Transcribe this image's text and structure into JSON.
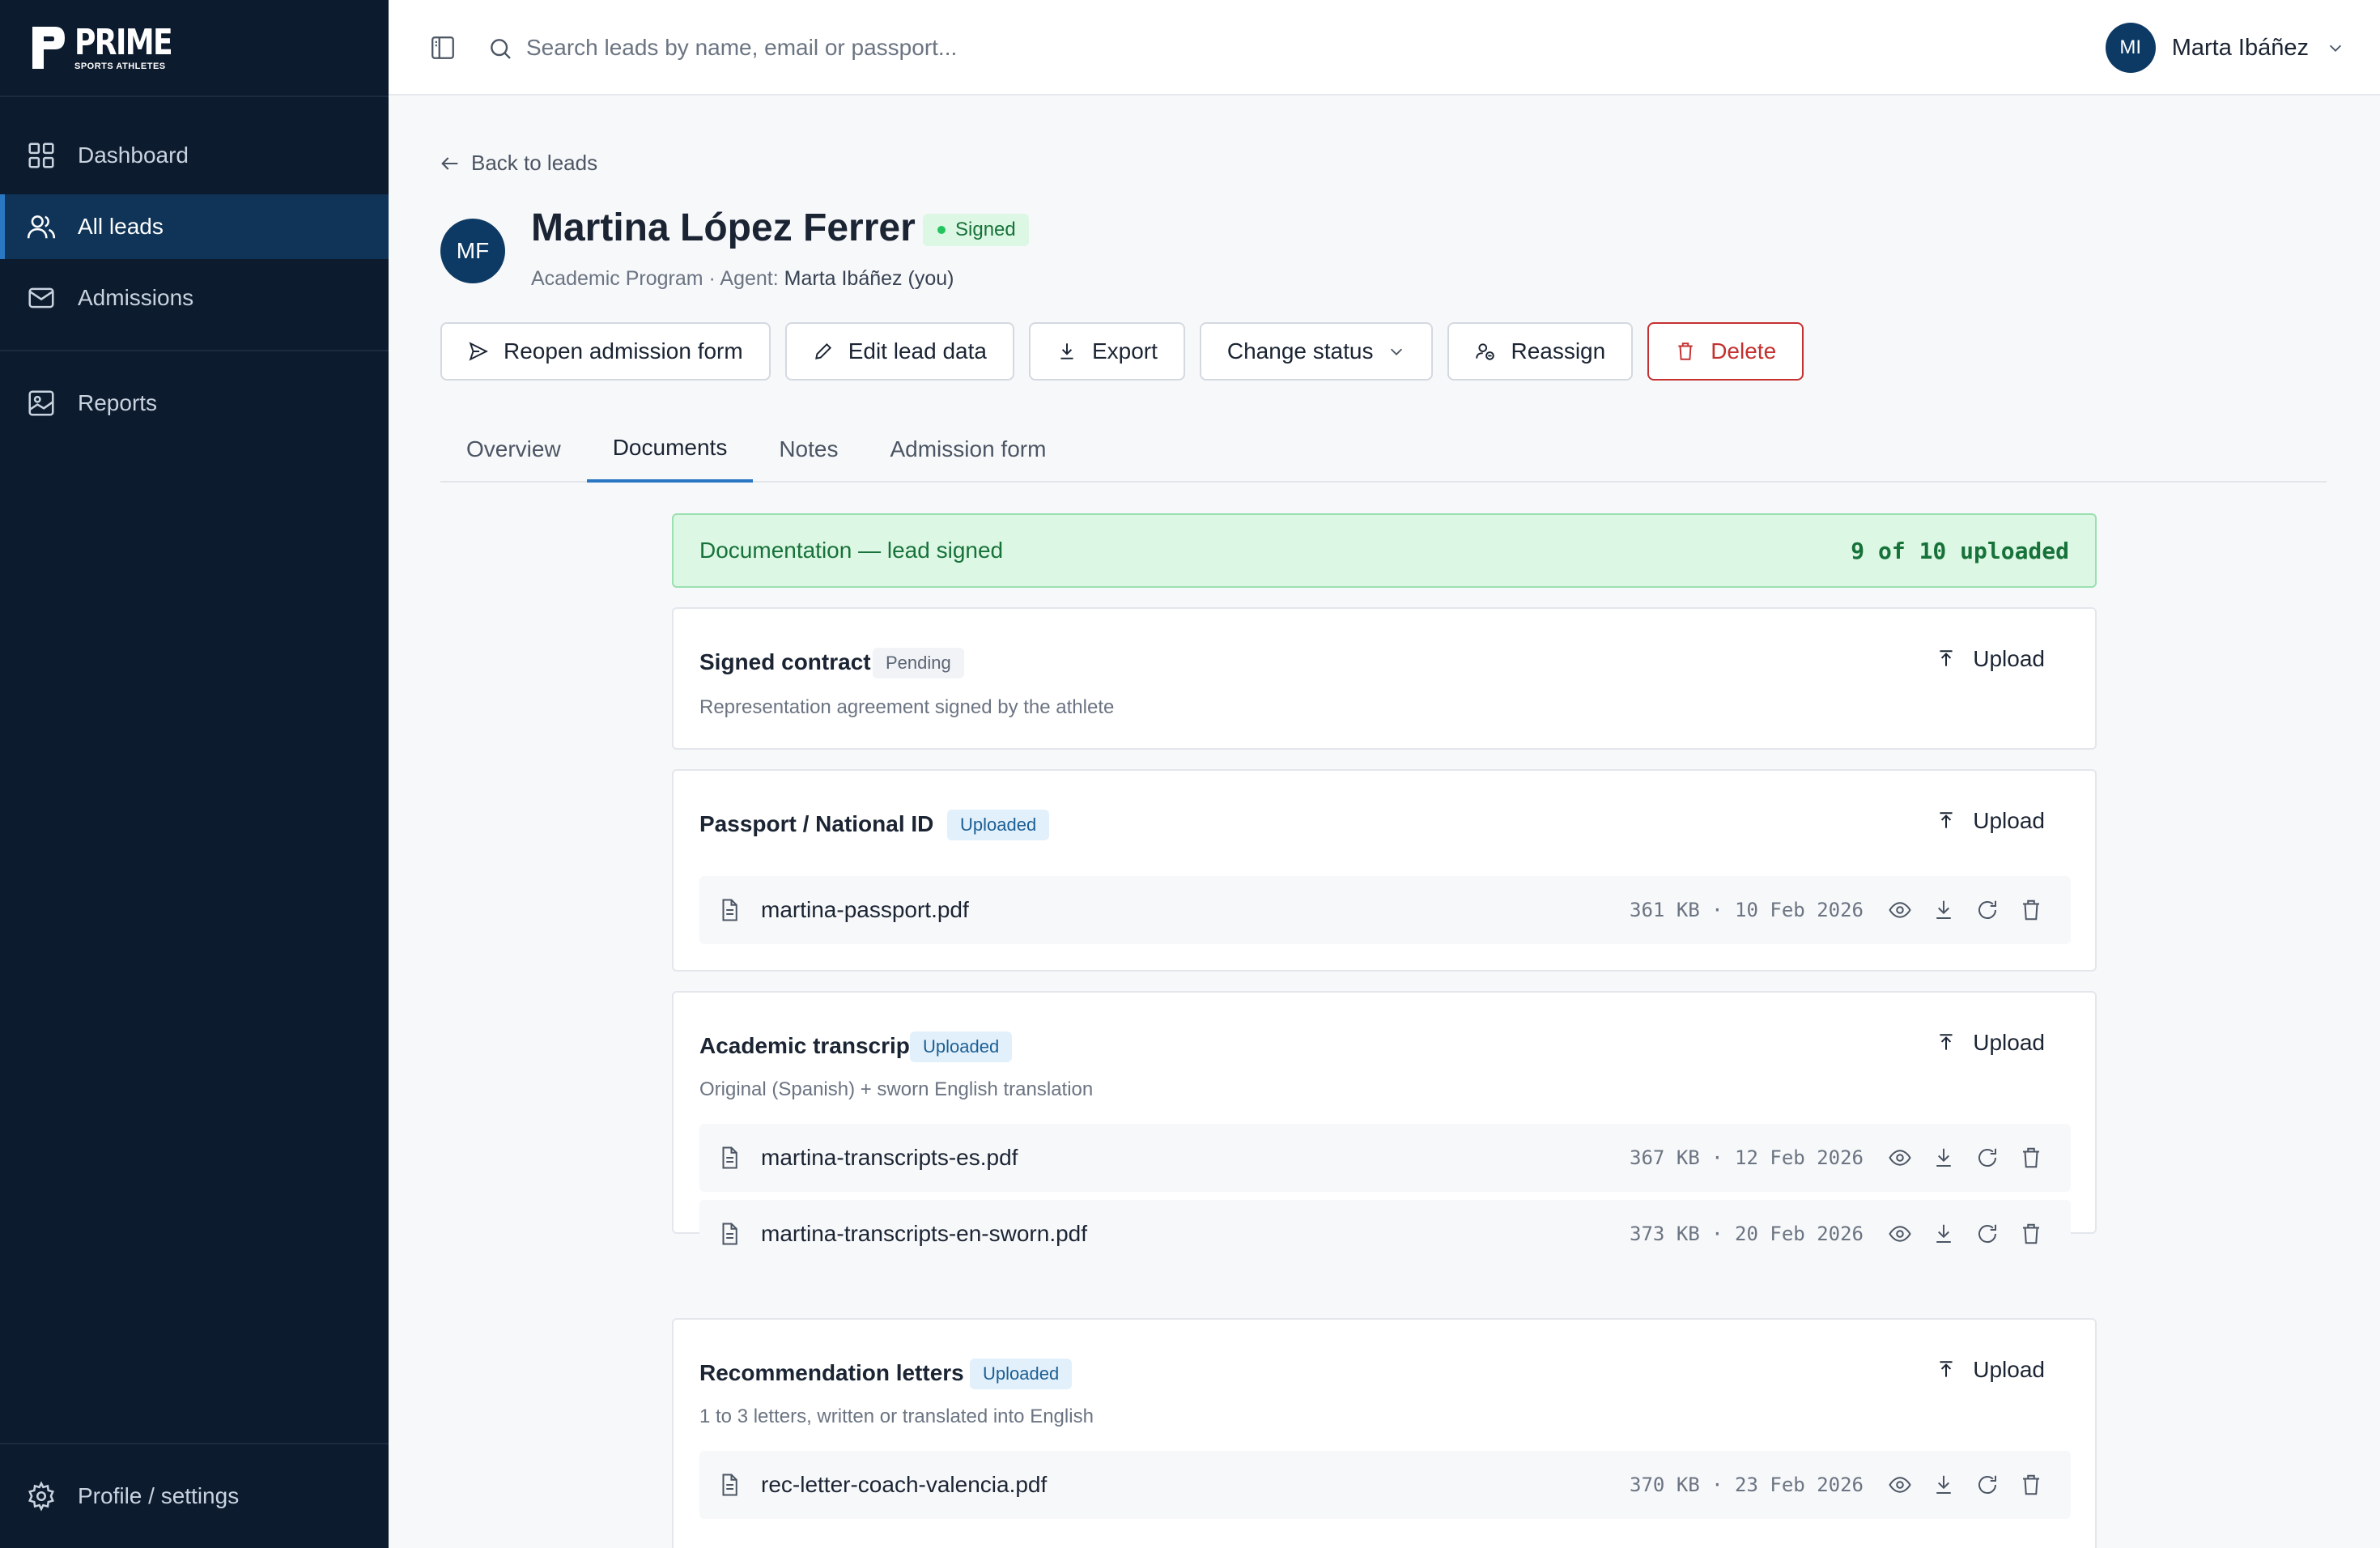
{
  "brand": {
    "name": "PRIME",
    "sub": "SPORTS ATHLETES"
  },
  "sidebar": {
    "items": [
      {
        "label": "Dashboard",
        "icon": "grid-icon"
      },
      {
        "label": "All leads",
        "icon": "users-icon"
      },
      {
        "label": "Admissions",
        "icon": "mail-icon"
      },
      {
        "label": "Reports",
        "icon": "report-icon"
      }
    ],
    "footer": {
      "label": "Profile / settings",
      "icon": "gear-icon"
    }
  },
  "topbar": {
    "search_placeholder": "Search leads by name, email or passport...",
    "user": {
      "initials": "MI",
      "name": "Marta Ibáñez"
    }
  },
  "lead": {
    "back_label": "Back to leads",
    "initials": "MF",
    "name": "Martina López Ferrer",
    "status": "Signed",
    "program": "Academic Program · Agent: ",
    "agent": "Marta Ibáñez (you)"
  },
  "actions": {
    "reopen": "Reopen admission form",
    "edit": "Edit lead data",
    "export": "Export",
    "change_status": "Change status",
    "reassign": "Reassign",
    "delete": "Delete"
  },
  "tabs": [
    "Overview",
    "Documents",
    "Notes",
    "Admission form"
  ],
  "active_tab": "Documents",
  "banner": {
    "label": "Documentation — lead signed",
    "count": "9 of 10 uploaded"
  },
  "documents": [
    {
      "title": "Signed contract",
      "status": "Pending",
      "description": "Representation agreement signed by the athlete",
      "upload_label": "Upload",
      "files": []
    },
    {
      "title": "Passport / National ID",
      "status": "Uploaded",
      "description": "",
      "upload_label": "Upload",
      "files": [
        {
          "name": "martina-passport.pdf",
          "meta": "361 KB · 10 Feb 2026"
        }
      ]
    },
    {
      "title": "Academic transcripts",
      "status": "Uploaded",
      "description": "Original (Spanish) + sworn English translation",
      "upload_label": "Upload",
      "files": [
        {
          "name": "martina-transcripts-es.pdf",
          "meta": "367 KB · 12 Feb 2026"
        },
        {
          "name": "martina-transcripts-en-sworn.pdf",
          "meta": "373 KB · 20 Feb 2026"
        }
      ]
    },
    {
      "title": "Recommendation letters",
      "status": "Uploaded",
      "description": "1 to 3 letters, written or translated into English",
      "upload_label": "Upload",
      "files": [
        {
          "name": "rec-letter-coach-valencia.pdf",
          "meta": "370 KB · 23 Feb 2026"
        }
      ]
    }
  ],
  "colors": {
    "sidebar": "#0d1b2e",
    "accent": "#2a78c4",
    "danger": "#c53030",
    "success": "#17723a"
  }
}
